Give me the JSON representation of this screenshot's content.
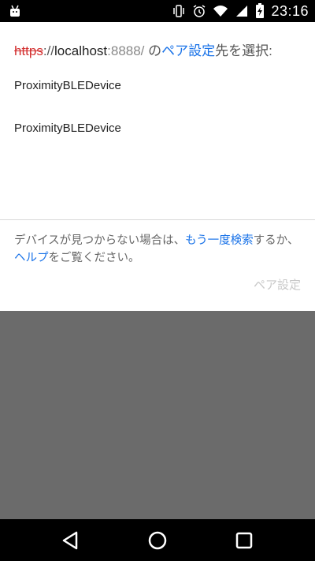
{
  "status_bar": {
    "time": "23:16",
    "icons": [
      "android-icon",
      "vibrate-icon",
      "alarm-icon",
      "wifi-icon",
      "signal-icon",
      "battery-icon"
    ]
  },
  "dialog": {
    "header": {
      "protocol": "https",
      "separator": "://",
      "host": "localhost",
      "port": ":8888/",
      "text_mid": " の",
      "link": "ペア設定",
      "text_end": "先を選択:"
    },
    "devices": [
      {
        "name": "ProximityBLEDevice"
      },
      {
        "name": "ProximityBLEDevice"
      }
    ],
    "footer": {
      "text_before": "デバイスが見つからない場合は、",
      "rescan_link": "もう一度検索",
      "text_middle": "するか、",
      "help_link": "ヘルプ",
      "text_after": "をご覧ください。"
    },
    "pair_button": "ペア設定"
  },
  "colors": {
    "accent": "#1a73e8",
    "insecure_protocol": "#d32f2f",
    "backdrop": "#6b6b6b"
  },
  "nav_bar": {
    "icons": [
      "back-icon",
      "home-icon",
      "recents-icon"
    ]
  }
}
